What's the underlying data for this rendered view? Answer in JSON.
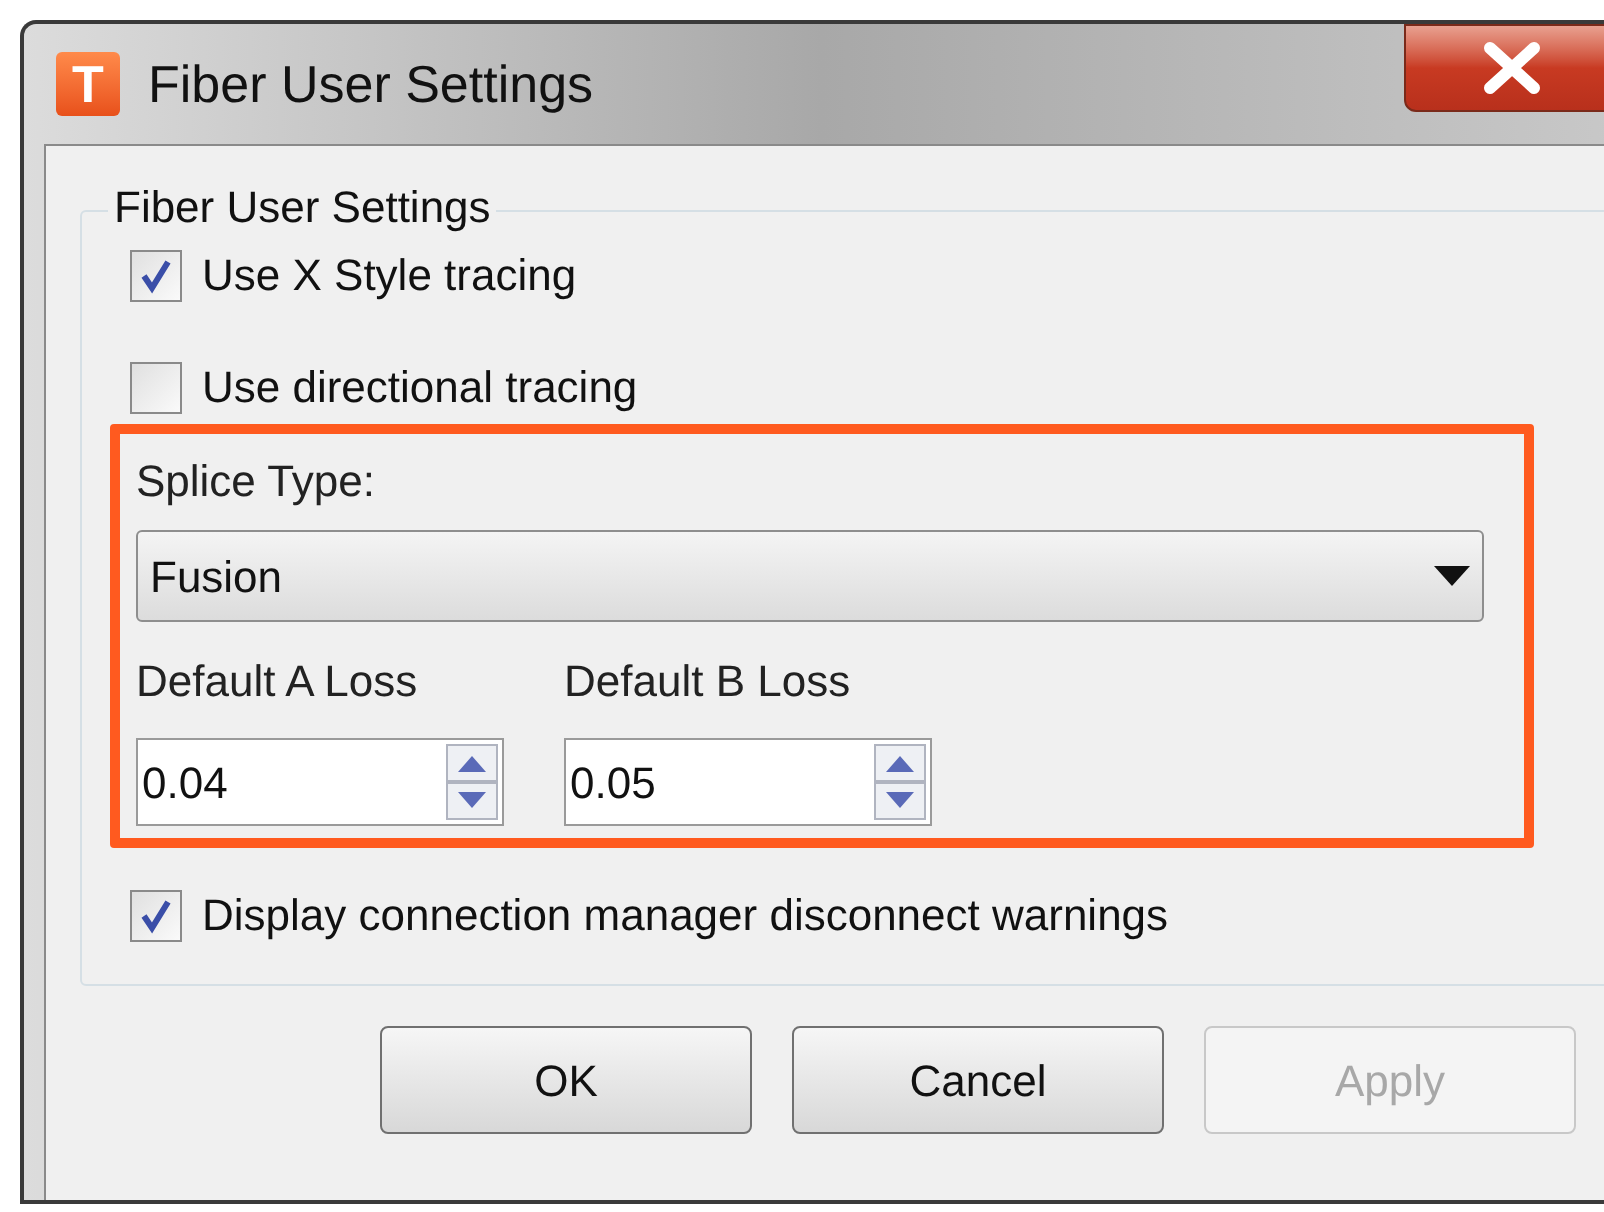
{
  "window": {
    "icon_letter": "T",
    "title": "Fiber User Settings"
  },
  "group": {
    "legend": "Fiber User Settings"
  },
  "options_top": [
    {
      "label": "Use X Style tracing",
      "checked": true
    },
    {
      "label": "Use directional tracing",
      "checked": false
    }
  ],
  "splice": {
    "label": "Splice Type:",
    "value": "Fusion"
  },
  "losses": [
    {
      "label": "Default A Loss",
      "value": "0.04"
    },
    {
      "label": "Default B Loss",
      "value": "0.05"
    }
  ],
  "options_bottom": [
    {
      "label": "Display connection manager disconnect warnings",
      "checked": true
    }
  ],
  "buttons": [
    {
      "label": "OK",
      "disabled": false
    },
    {
      "label": "Cancel",
      "disabled": false
    },
    {
      "label": "Apply",
      "disabled": true
    }
  ]
}
